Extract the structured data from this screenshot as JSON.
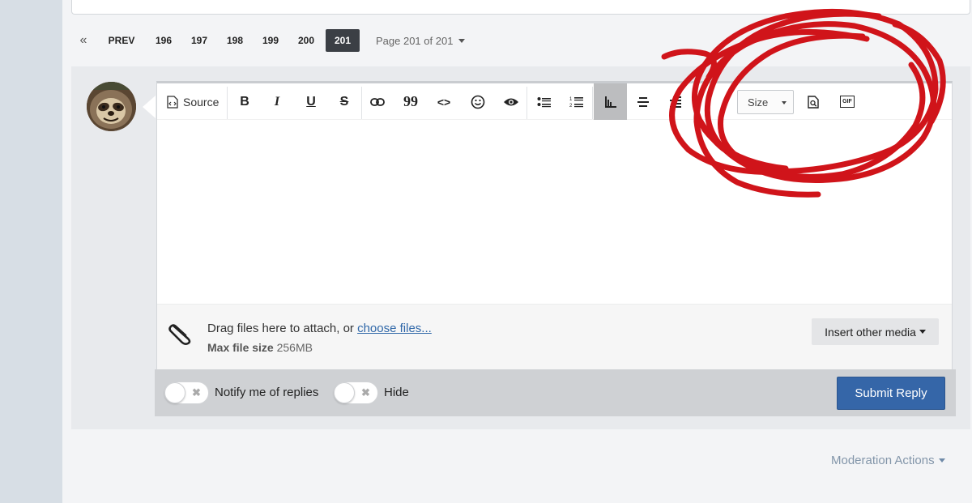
{
  "pagination": {
    "first_icon": "«",
    "prev_label": "PREV",
    "pages": [
      "196",
      "197",
      "198",
      "199",
      "200"
    ],
    "current_page": "201",
    "jump_label": "Page 201 of 201"
  },
  "editor": {
    "toolbar": {
      "source_label": "Source",
      "bold": "B",
      "italic": "I",
      "underline": "U",
      "strike": "S",
      "quote": "99",
      "code": "<>",
      "size_label": "Size",
      "gif_label": "GIF",
      "icons": [
        "source-icon",
        "bold-icon",
        "italic-icon",
        "underline-icon",
        "strikethrough-icon",
        "link-icon",
        "quote-icon",
        "code-icon",
        "emoji-icon",
        "spoiler-eye-icon",
        "bullet-list-icon",
        "numbered-list-icon",
        "align-left-icon",
        "align-center-icon",
        "align-right-icon",
        "preview-icon",
        "gif-icon"
      ]
    },
    "attach": {
      "drag_text": "Drag files here to attach, or ",
      "choose_link": "choose files...",
      "max_label": "Max file size",
      "max_value": "256MB",
      "insert_media": "Insert other media"
    }
  },
  "footer": {
    "notify_label": "Notify me of replies",
    "hide_label": "Hide",
    "submit_label": "Submit Reply"
  },
  "moderation": {
    "label": "Moderation Actions"
  },
  "colors": {
    "accent": "#3566a8",
    "annotation": "#d0141a",
    "active_page": "#3b3f45"
  }
}
